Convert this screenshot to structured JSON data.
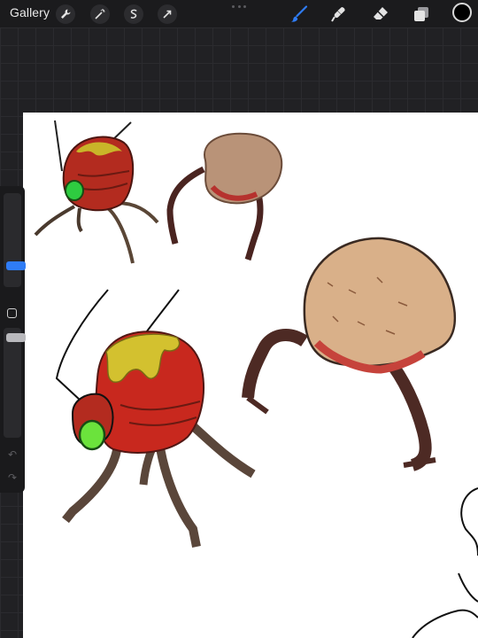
{
  "topbar": {
    "gallery_label": "Gallery",
    "left_tools": [
      "wrench-icon",
      "magic-wand-icon",
      "selection-icon",
      "transform-arrow-icon"
    ],
    "right_tools": [
      "brush-icon",
      "smudge-icon",
      "eraser-icon",
      "layers-icon"
    ],
    "active_tool": "brush-icon",
    "current_color": "#000000",
    "accent_color": "#2f7cf6"
  },
  "sidebar": {
    "size_slider_level": 0.2,
    "opacity_slider_level": 0.95,
    "controls": [
      "brush-size-slider",
      "modify-button",
      "opacity-slider",
      "undo-icon",
      "redo-icon"
    ]
  },
  "canvas": {
    "background": "#ffffff",
    "contents": [
      "red-insect-creature-reference",
      "flesh-creature-reference",
      "red-insect-creature-sketch",
      "flesh-creature-sketch",
      "partial-line-sketches"
    ]
  }
}
